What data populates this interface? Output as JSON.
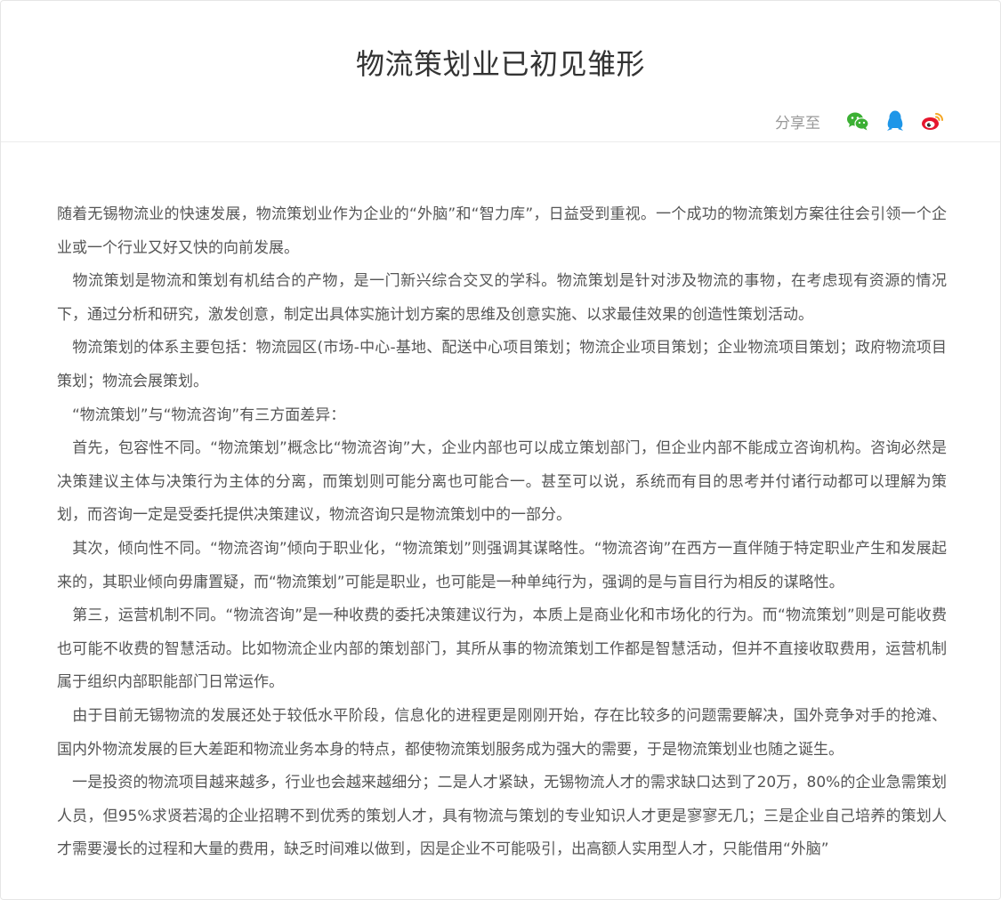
{
  "article": {
    "title": "物流策划业已初见雏形",
    "share_label": "分享至",
    "share_icons": [
      "wechat-icon",
      "qq-icon",
      "weibo-icon"
    ],
    "paragraphs": [
      "随着无锡物流业的快速发展，物流策划业作为企业的“外脑”和“智力库”，日益受到重视。一个成功的物流策划方案往往会引领一个企业或一个行业又好又快的向前发展。",
      "　物流策划是物流和策划有机结合的产物，是一门新兴综合交叉的学科。物流策划是针对涉及物流的事物，在考虑现有资源的情况下，通过分析和研究，激发创意，制定出具体实施计划方案的思维及创意实施、以求最佳效果的创造性策划活动。",
      "　物流策划的体系主要包括：物流园区(市场-中心-基地、配送中心项目策划；物流企业项目策划；企业物流项目策划；政府物流项目策划；物流会展策划。",
      "　“物流策划”与“物流咨询”有三方面差异：",
      "　首先，包容性不同。“物流策划”概念比“物流咨询”大，企业内部也可以成立策划部门，但企业内部不能成立咨询机构。咨询必然是决策建议主体与决策行为主体的分离，而策划则可能分离也可能合一。甚至可以说，系统而有目的思考并付诸行动都可以理解为策划，而咨询一定是受委托提供决策建议，物流咨询只是物流策划中的一部分。",
      "　其次，倾向性不同。“物流咨询”倾向于职业化，“物流策划”则强调其谋略性。“物流咨询”在西方一直伴随于特定职业产生和发展起来的，其职业倾向毋庸置疑，而“物流策划”可能是职业，也可能是一种单纯行为，强调的是与盲目行为相反的谋略性。",
      "　第三，运营机制不同。“物流咨询”是一种收费的委托决策建议行为，本质上是商业化和市场化的行为。而“物流策划”则是可能收费也可能不收费的智慧活动。比如物流企业内部的策划部门，其所从事的物流策划工作都是智慧活动，但并不直接收取费用，运营机制属于组织内部职能部门日常运作。",
      "　由于目前无锡物流的发展还处于较低水平阶段，信息化的进程更是刚刚开始，存在比较多的问题需要解决，国外竞争对手的抢滩、国内外物流发展的巨大差距和物流业务本身的特点，都使物流策划服务成为强大的需要，于是物流策划业也随之诞生。",
      "　一是投资的物流项目越来越多，行业也会越来越细分；二是人才紧缺，无锡物流人才的需求缺口达到了20万，80%的企业急需策划人员，但95%求贤若渴的企业招聘不到优秀的策划人才，具有物流与策划的专业知识人才更是寥寥无几；三是企业自己培养的策划人才需要漫长的过程和大量的费用，缺乏时间难以做到，因是企业不可能吸引，出高额人实用型人才，只能借用“外脑”"
    ]
  },
  "colors": {
    "wechat": "#3cb034",
    "qq": "#1e96e8",
    "weibo": "#e6162d",
    "weibo_eye": "#f5a623",
    "title": "#333333",
    "body": "#555555",
    "muted": "#999999"
  }
}
